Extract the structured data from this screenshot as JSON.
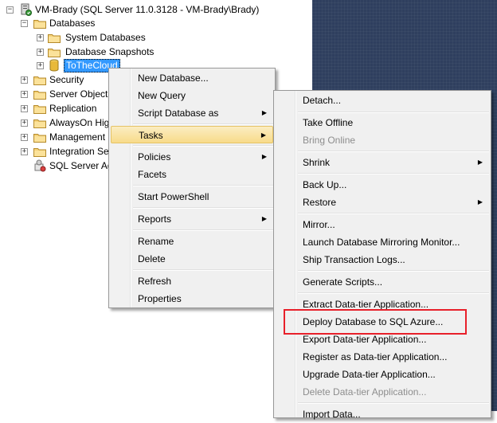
{
  "tree": {
    "server_label": "VM-Brady (SQL Server 11.0.3128 - VM-Brady\\Brady)",
    "nodes": [
      {
        "label": "Databases",
        "expander": "−"
      },
      {
        "label": "System Databases",
        "expander": "+"
      },
      {
        "label": "Database Snapshots",
        "expander": "+"
      },
      {
        "label": "ToTheCloud",
        "expander": "+"
      },
      {
        "label": "Security",
        "expander": "+"
      },
      {
        "label": "Server Objects",
        "expander": "+"
      },
      {
        "label": "Replication",
        "expander": "+"
      },
      {
        "label": "AlwaysOn High",
        "expander": "+"
      },
      {
        "label": "Management",
        "expander": "+"
      },
      {
        "label": "Integration Se",
        "expander": "+"
      },
      {
        "label": "SQL Server Ag",
        "expander": ""
      }
    ],
    "server_expander": "−"
  },
  "context_menu": {
    "items": [
      {
        "label": "New Database...",
        "arrow": ""
      },
      {
        "label": "New Query",
        "arrow": ""
      },
      {
        "label": "Script Database as",
        "arrow": "▶"
      },
      {
        "label": "Tasks",
        "arrow": "▶"
      },
      {
        "label": "Policies",
        "arrow": "▶"
      },
      {
        "label": "Facets",
        "arrow": ""
      },
      {
        "label": "Start PowerShell",
        "arrow": ""
      },
      {
        "label": "Reports",
        "arrow": "▶"
      },
      {
        "label": "Rename",
        "arrow": ""
      },
      {
        "label": "Delete",
        "arrow": ""
      },
      {
        "label": "Refresh",
        "arrow": ""
      },
      {
        "label": "Properties",
        "arrow": ""
      }
    ]
  },
  "tasks_menu": {
    "items": [
      {
        "label": "Detach...",
        "arrow": ""
      },
      {
        "label": "Take Offline",
        "arrow": ""
      },
      {
        "label": "Bring Online",
        "arrow": ""
      },
      {
        "label": "Shrink",
        "arrow": "▶"
      },
      {
        "label": "Back Up...",
        "arrow": ""
      },
      {
        "label": "Restore",
        "arrow": "▶"
      },
      {
        "label": "Mirror...",
        "arrow": ""
      },
      {
        "label": "Launch Database Mirroring Monitor...",
        "arrow": ""
      },
      {
        "label": "Ship Transaction Logs...",
        "arrow": ""
      },
      {
        "label": "Generate Scripts...",
        "arrow": ""
      },
      {
        "label": "Extract Data-tier Application...",
        "arrow": ""
      },
      {
        "label": "Deploy Database to SQL Azure...",
        "arrow": ""
      },
      {
        "label": "Export Data-tier Application...",
        "arrow": ""
      },
      {
        "label": "Register as Data-tier Application...",
        "arrow": ""
      },
      {
        "label": "Upgrade Data-tier Application...",
        "arrow": ""
      },
      {
        "label": "Delete Data-tier Application...",
        "arrow": ""
      },
      {
        "label": "Import Data...",
        "arrow": ""
      }
    ]
  },
  "colors": {
    "highlight": "#f8db8a",
    "annotation": "#e8202a",
    "selection": "#3399ff",
    "background_pane": "#2f3f5e"
  }
}
